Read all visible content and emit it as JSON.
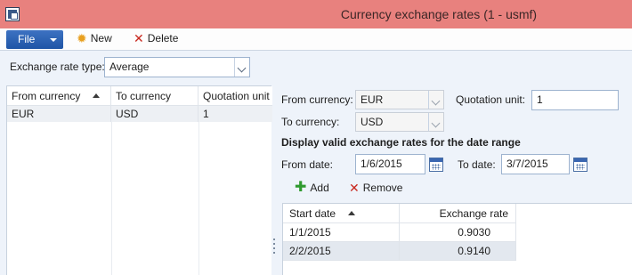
{
  "window": {
    "title": "Currency exchange rates (1 - usmf)"
  },
  "toolbar": {
    "file_label": "File",
    "new_label": "New",
    "delete_label": "Delete"
  },
  "filter": {
    "label": "Exchange rate type:",
    "value": "Average"
  },
  "left_grid": {
    "columns": [
      "From currency",
      "To currency",
      "Quotation unit"
    ],
    "rows": [
      {
        "from": "EUR",
        "to": "USD",
        "unit": "1"
      }
    ]
  },
  "detail": {
    "from_currency_label": "From currency:",
    "from_currency_value": "EUR",
    "quotation_unit_label": "Quotation unit:",
    "quotation_unit_value": "1",
    "to_currency_label": "To currency:",
    "to_currency_value": "USD",
    "range_heading": "Display valid exchange rates for the date range",
    "from_date_label": "From date:",
    "from_date_value": "1/6/2015",
    "to_date_label": "To date:",
    "to_date_value": "3/7/2015"
  },
  "rates_toolbar": {
    "add_label": "Add",
    "remove_label": "Remove"
  },
  "rates_grid": {
    "columns": [
      "Start date",
      "Exchange rate"
    ],
    "rows": [
      {
        "start_date": "1/1/2015",
        "rate": "0.9030"
      },
      {
        "start_date": "2/2/2015",
        "rate": "0.9140"
      }
    ]
  }
}
